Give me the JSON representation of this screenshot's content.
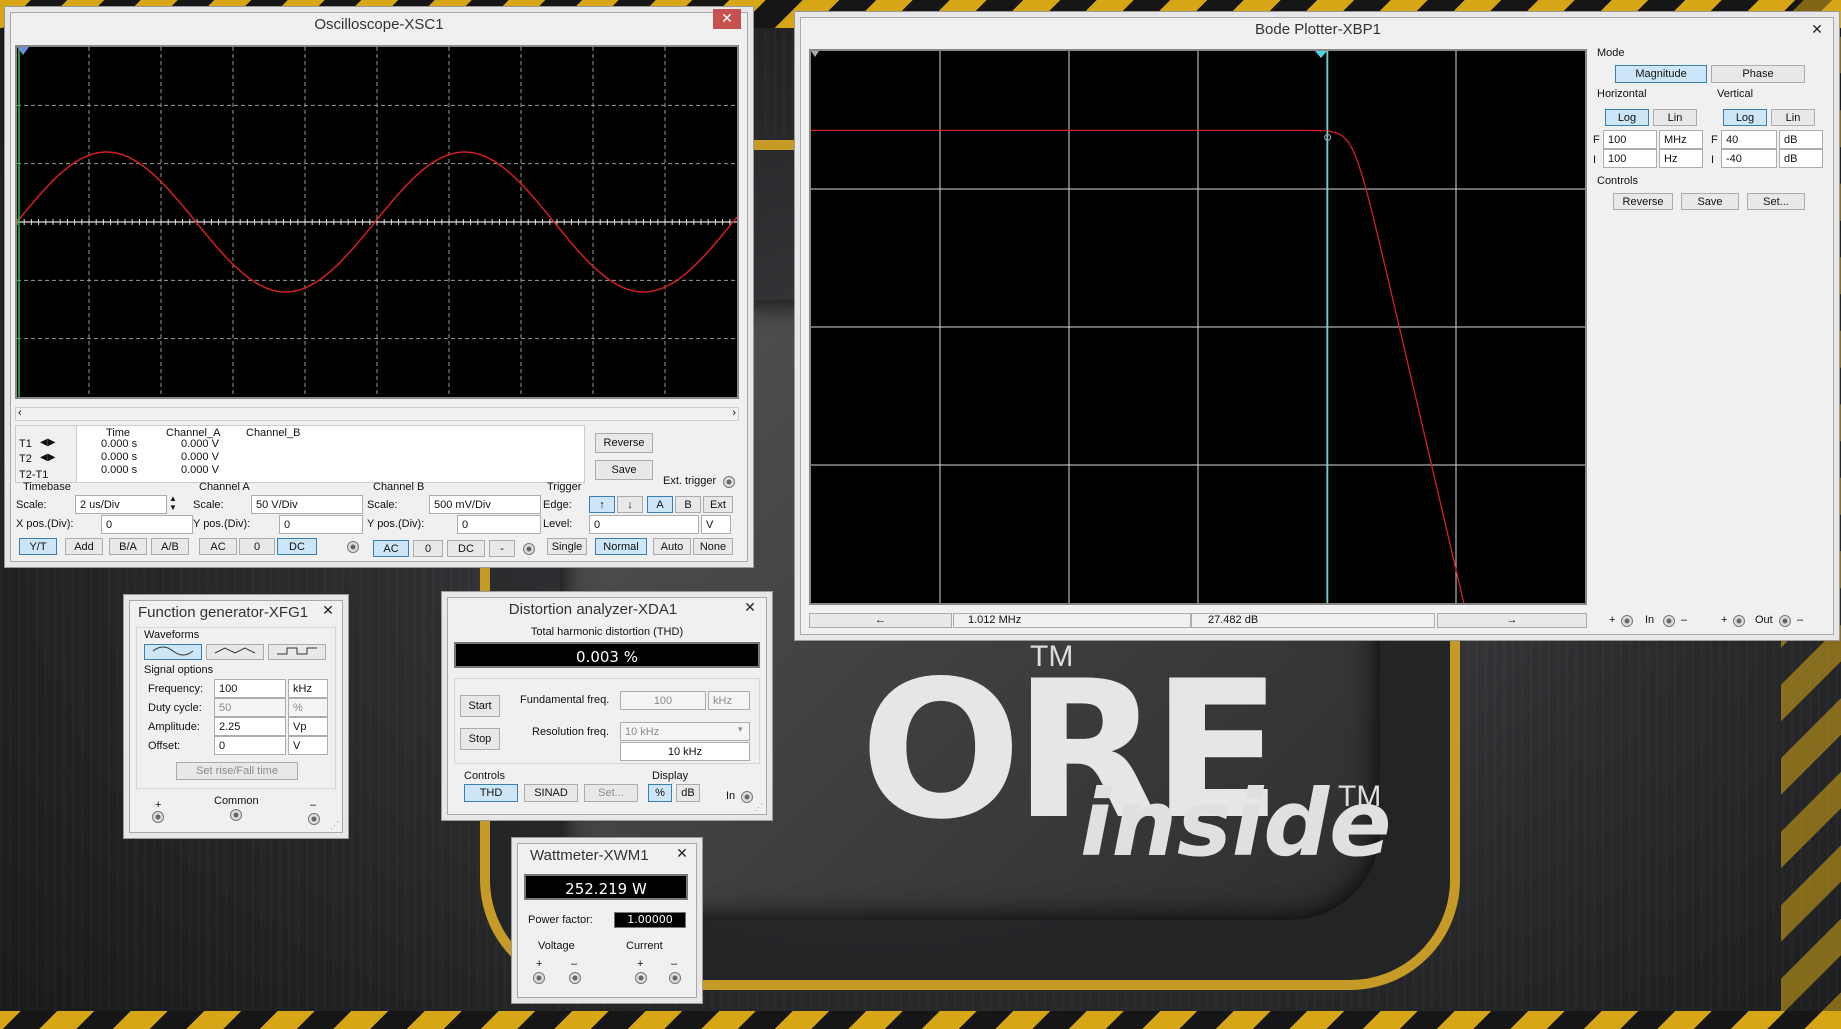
{
  "oscilloscope": {
    "title": "Oscilloscope-XSC1",
    "close": "✕",
    "readout": {
      "headers": [
        "Time",
        "Channel_A",
        "Channel_B"
      ],
      "rows": [
        {
          "label": "T1",
          "time": "0.000 s",
          "a": "0.000 V",
          "b": ""
        },
        {
          "label": "T2",
          "time": "0.000 s",
          "a": "0.000 V",
          "b": ""
        },
        {
          "label": "T2-T1",
          "time": "0.000 s",
          "a": "0.000 V",
          "b": ""
        }
      ]
    },
    "reverse": "Reverse",
    "save": "Save",
    "ext_trigger": "Ext. trigger",
    "timebase": {
      "title": "Timebase",
      "scale_label": "Scale:",
      "scale": "2 us/Div",
      "xpos_label": "X pos.(Div):",
      "xpos": "0",
      "buttons": [
        "Y/T",
        "Add",
        "B/A",
        "A/B"
      ]
    },
    "channel_a": {
      "title": "Channel A",
      "scale_label": "Scale:",
      "scale": "50  V/Div",
      "ypos_label": "Y pos.(Div):",
      "ypos": "0",
      "buttons": [
        "AC",
        "0",
        "DC"
      ]
    },
    "channel_b": {
      "title": "Channel B",
      "scale_label": "Scale:",
      "scale": "500 mV/Div",
      "ypos_label": "Y pos.(Div):",
      "ypos": "0",
      "buttons": [
        "AC",
        "0",
        "DC",
        "-"
      ]
    },
    "trigger": {
      "title": "Trigger",
      "edge_label": "Edge:",
      "edge_buttons": [
        "A",
        "B",
        "Ext"
      ],
      "level_label": "Level:",
      "level": "0",
      "level_unit": "V",
      "mode_buttons": [
        "Single",
        "Normal",
        "Auto",
        "None"
      ]
    },
    "trace_color": "#d42020"
  },
  "bode": {
    "title": "Bode Plotter-XBP1",
    "close": "✕",
    "mode_label": "Mode",
    "magnitude": "Magnitude",
    "phase": "Phase",
    "horizontal_label": "Horizontal",
    "vertical_label": "Vertical",
    "log": "Log",
    "lin": "Lin",
    "h_f_label": "F",
    "h_f_value": "100",
    "h_f_unit": "MHz",
    "h_i_label": "I",
    "h_i_value": "100",
    "h_i_unit": "Hz",
    "v_f_label": "F",
    "v_f_value": "40",
    "v_f_unit": "dB",
    "v_i_label": "I",
    "v_i_value": "-40",
    "v_i_unit": "dB",
    "controls_label": "Controls",
    "reverse": "Reverse",
    "save": "Save",
    "set": "Set...",
    "cursor_freq": "1.012 MHz",
    "cursor_gain": "27.482 dB",
    "in_label": "In",
    "out_label": "Out",
    "plus": "+",
    "minus": "–",
    "trace_color": "#d42020",
    "cursor_color": "#4fd6e0"
  },
  "function_generator": {
    "title": "Function generator-XFG1",
    "close": "✕",
    "waveforms_label": "Waveforms",
    "signal_options_label": "Signal options",
    "frequency_label": "Frequency:",
    "frequency": "100",
    "frequency_unit": "kHz",
    "duty_label": "Duty cycle:",
    "duty": "50",
    "duty_unit": "%",
    "amplitude_label": "Amplitude:",
    "amplitude": "2.25",
    "amplitude_unit": "Vp",
    "offset_label": "Offset:",
    "offset": "0",
    "offset_unit": "V",
    "rise_fall": "Set rise/Fall time",
    "plus": "+",
    "common": "Common",
    "minus": "–"
  },
  "distortion": {
    "title": "Distortion analyzer-XDA1",
    "close": "✕",
    "thd_label": "Total harmonic distortion (THD)",
    "thd_value": "0.003 %",
    "start": "Start",
    "stop": "Stop",
    "fund_label": "Fundamental freq.",
    "fund_value": "100",
    "fund_unit": "kHz",
    "res_label": "Resolution freq.",
    "res_value": "10 kHz",
    "res_display": "10 kHz",
    "controls_label": "Controls",
    "display_label": "Display",
    "thd_btn": "THD",
    "sinad_btn": "SINAD",
    "set_btn": "Set...",
    "pct_btn": "%",
    "db_btn": "dB",
    "in_label": "In"
  },
  "wattmeter": {
    "title": "Wattmeter-XWM1",
    "close": "✕",
    "power": "252.219 W",
    "pf_label": "Power factor:",
    "pf_value": "1.00000",
    "voltage_label": "Voltage",
    "current_label": "Current",
    "plus": "+",
    "minus": "–"
  },
  "desktop": {
    "logo_text": "ORE",
    "logo_inside": "inside",
    "tm": "TM",
    "accent": "#c59a27"
  }
}
